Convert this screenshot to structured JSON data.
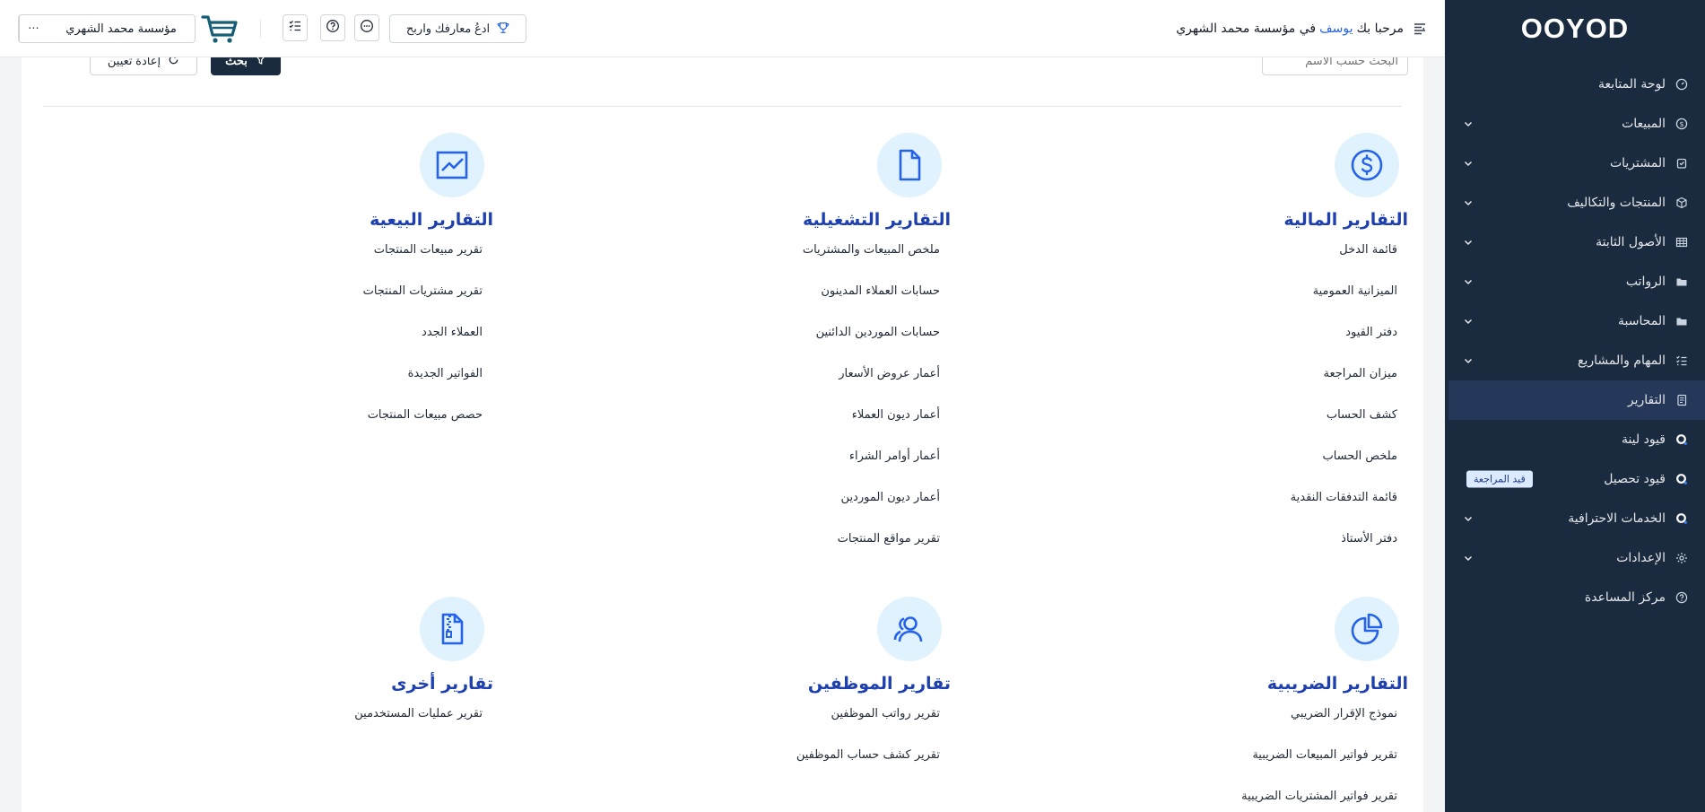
{
  "brand": {
    "logo": "OOYOD"
  },
  "header": {
    "welcome_prefix": "مرحبا بك",
    "user_name": "يوسف",
    "welcome_suffix": "في مؤسسة محمد الشهري",
    "invite_label": "ادعُ معارفك واربح",
    "org_name": "مؤسسة محمد الشهري",
    "more_label": "···"
  },
  "sidebar": {
    "items": [
      {
        "label": "لوحة المتابعة",
        "icon": "dashboard-icon",
        "has_children": false
      },
      {
        "label": "المبيعات",
        "icon": "dollar-circle-icon",
        "has_children": true
      },
      {
        "label": "المشتريات",
        "icon": "purchase-icon",
        "has_children": true
      },
      {
        "label": "المنتجات والتكاليف",
        "icon": "box-icon",
        "has_children": true
      },
      {
        "label": "الأصول الثابتة",
        "icon": "table-icon",
        "has_children": true
      },
      {
        "label": "الرواتب",
        "icon": "folder-icon",
        "has_children": true
      },
      {
        "label": "المحاسبة",
        "icon": "folder-icon",
        "has_children": true
      },
      {
        "label": "المهام والمشاريع",
        "icon": "task-list-icon",
        "has_children": true
      },
      {
        "label": "التقارير",
        "icon": "report-icon",
        "has_children": false,
        "active": true
      },
      {
        "label": "قيود لينة",
        "icon": "lean-icon",
        "has_children": false
      },
      {
        "label": "قيود تحصيل",
        "icon": "lean-icon",
        "has_children": false,
        "badge": "قيد المراجعة"
      },
      {
        "label": "الخدمات الاحترافية",
        "icon": "lean-icon",
        "has_children": true
      },
      {
        "label": "الإعدادات",
        "icon": "gear-icon",
        "has_children": true
      },
      {
        "label": "مركز المساعدة",
        "icon": "help-icon",
        "has_children": false
      }
    ]
  },
  "filters": {
    "search_placeholder": "البحث حسب الاسم",
    "search_button": "بحث",
    "reset_button": "إعادة تعيين"
  },
  "sections": [
    {
      "title": "التقارير المالية",
      "icon": "dollar-circle-icon",
      "items": [
        "قائمة الدخل",
        "الميزانية العمومية",
        "دفتر القيود",
        "ميزان المراجعة",
        "كشف الحساب",
        "ملخص الحساب",
        "قائمة التدفقات النقدية",
        "دفتر الأستاذ"
      ]
    },
    {
      "title": "التقارير التشغيلية",
      "icon": "document-icon",
      "items": [
        "ملخص المبيعات والمشتريات",
        "حسابات العملاء المدينون",
        "حسابات الموردين الدائنين",
        "أعمار عروض الأسعار",
        "أعمار ديون العملاء",
        "أعمار أوامر الشراء",
        "أعمار ديون الموردين",
        "تقرير مواقع المنتجات"
      ]
    },
    {
      "title": "التقارير البيعية",
      "icon": "trend-chart-icon",
      "items": [
        "تقرير مبيعات المنتجات",
        "تقرير مشتريات المنتجات",
        "العملاء الجدد",
        "الفواتير الجديدة",
        "حصص مبيعات المنتجات"
      ]
    },
    {
      "title": "التقارير الضريبية",
      "icon": "pie-chart-icon",
      "items": [
        "نموذج الإقرار الضريبي",
        "تقرير فواتير المبيعات الضريبية",
        "تقرير فواتير المشتريات الضريبية"
      ]
    },
    {
      "title": "تقارير الموظفين",
      "icon": "users-icon",
      "items": [
        "تقرير رواتب الموظفين",
        "تقرير كشف حساب الموظفين"
      ]
    },
    {
      "title": "تقارير أخرى",
      "icon": "zip-file-icon",
      "items": [
        "تقرير عمليات المستخدمين"
      ]
    }
  ],
  "colors": {
    "sidebar_bg": "#1b2b3f",
    "accent": "#1e40af",
    "icon_blue": "#2563eb",
    "icon_circle_bg": "#e0f2fe"
  }
}
